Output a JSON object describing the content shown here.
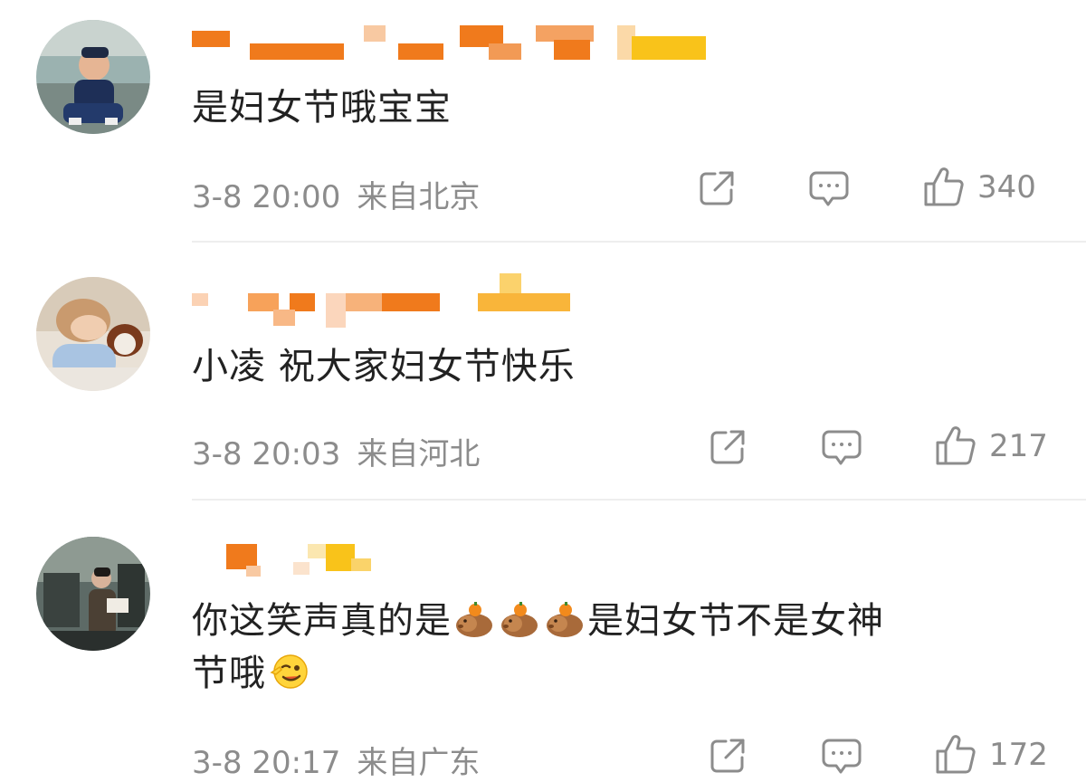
{
  "comments": [
    {
      "text": "是妇女节哦宝宝",
      "time": "3-8 20:00",
      "location": "来自北京",
      "likes": "340"
    },
    {
      "text": "小凌 祝大家妇女节快乐",
      "time": "3-8 20:03",
      "location": "来自河北",
      "likes": "217"
    },
    {
      "text_part1": "你这笑声真的是",
      "text_part2": "是妇女节不是女神",
      "text_part3": "节哦",
      "emoji_sequence": [
        "capybara-emoji",
        "capybara-emoji",
        "capybara-emoji"
      ],
      "trailing_emoji": "wink-emoji",
      "time": "3-8 20:17",
      "location": "来自广东",
      "likes": "172"
    }
  ],
  "icons": {
    "share": "share-icon",
    "comment": "comment-icon",
    "like": "thumbs-up-icon"
  },
  "colors": {
    "username_orange": "#f07a1c",
    "username_yellow": "#f9c31a",
    "meta_gray": "#8c8c8c"
  }
}
